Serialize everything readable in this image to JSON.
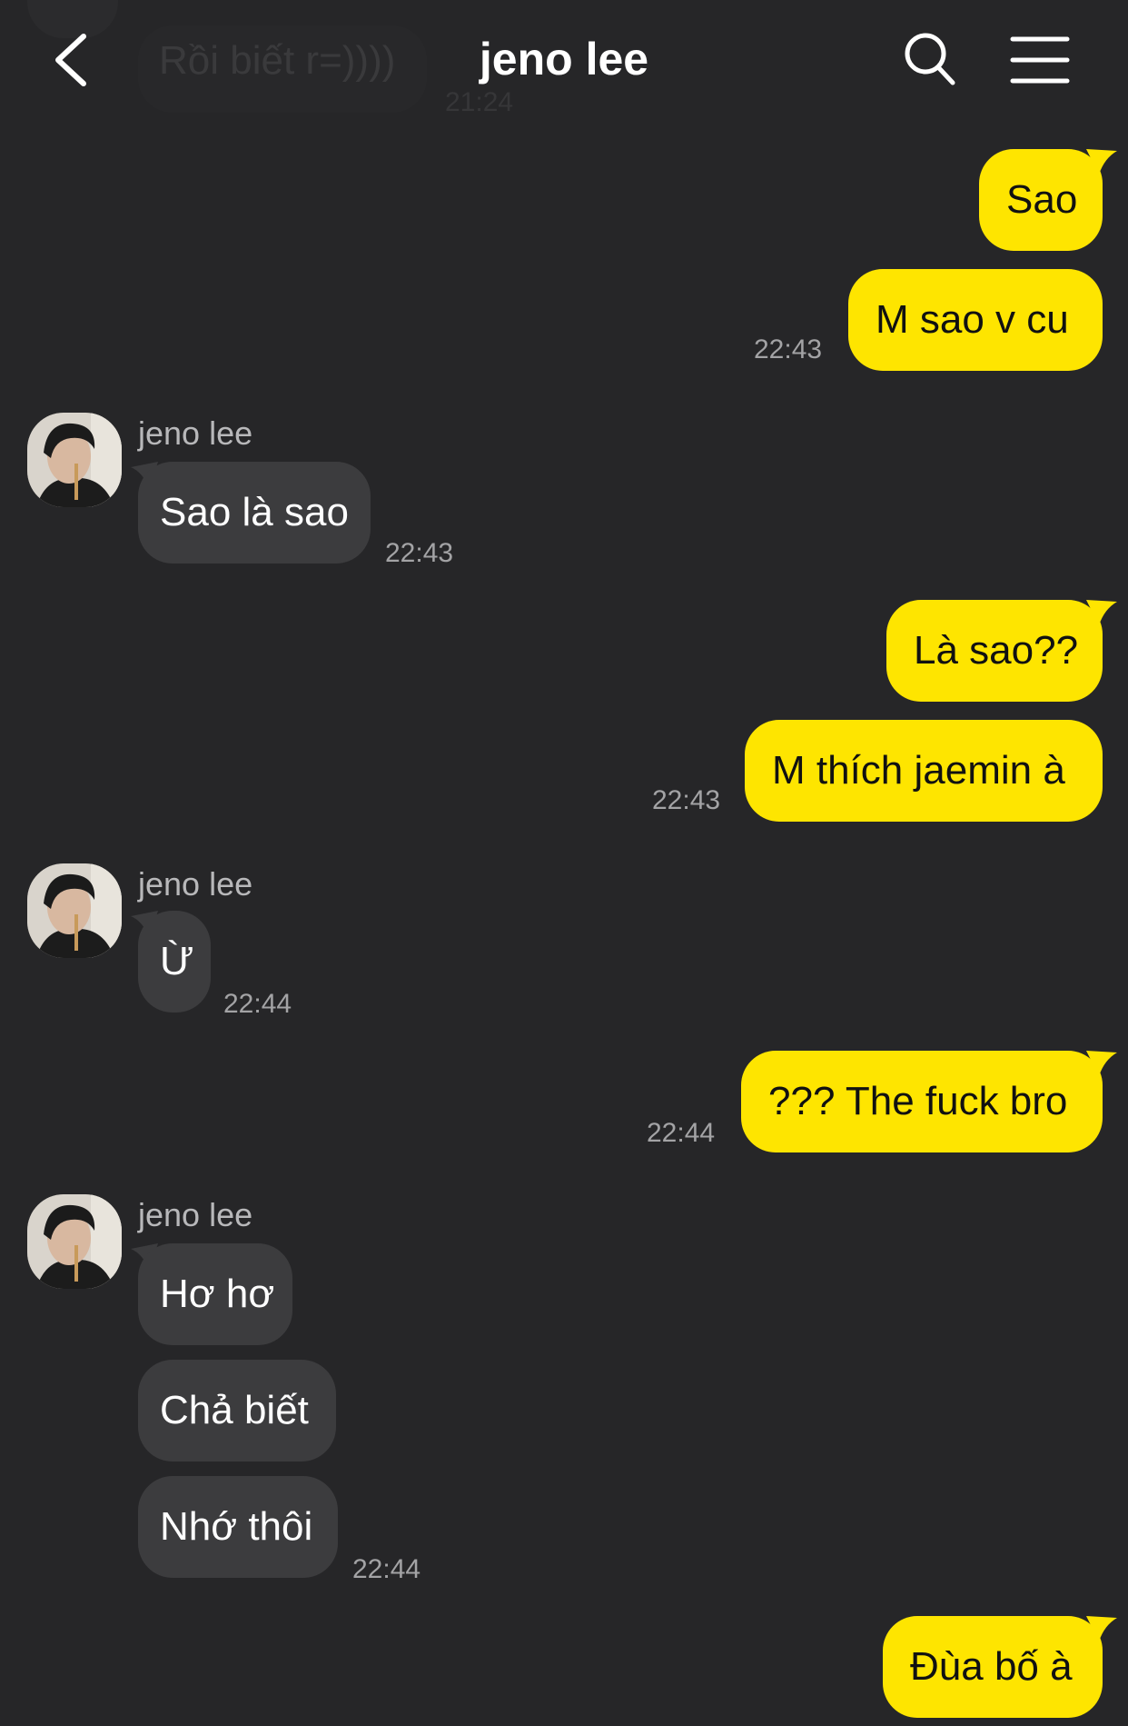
{
  "header": {
    "title": "jeno lee",
    "ghost_message": "Rồi biết r=))))",
    "ghost_time": "21:24"
  },
  "colors": {
    "background": "#262628",
    "outgoing_bubble": "#fee500",
    "incoming_bubble": "#3c3c3e"
  },
  "messages": {
    "m1": {
      "text": "Sao"
    },
    "m2": {
      "text": "M sao v cu",
      "time": "22:43"
    },
    "m3": {
      "sender": "jeno lee",
      "text": "Sao là sao",
      "time": "22:43"
    },
    "m4": {
      "text": "Là sao??"
    },
    "m5": {
      "text": "M thích jaemin à",
      "time": "22:43"
    },
    "m6": {
      "sender": "jeno lee",
      "text": "Ừ",
      "time": "22:44"
    },
    "m7": {
      "text": "??? The fuck bro",
      "time": "22:44"
    },
    "m8": {
      "sender": "jeno lee",
      "text": "Hơ hơ"
    },
    "m9": {
      "text": "Chả biết"
    },
    "m10": {
      "text": "Nhớ thôi",
      "time": "22:44"
    },
    "m11": {
      "text": "Đùa bố à"
    }
  }
}
